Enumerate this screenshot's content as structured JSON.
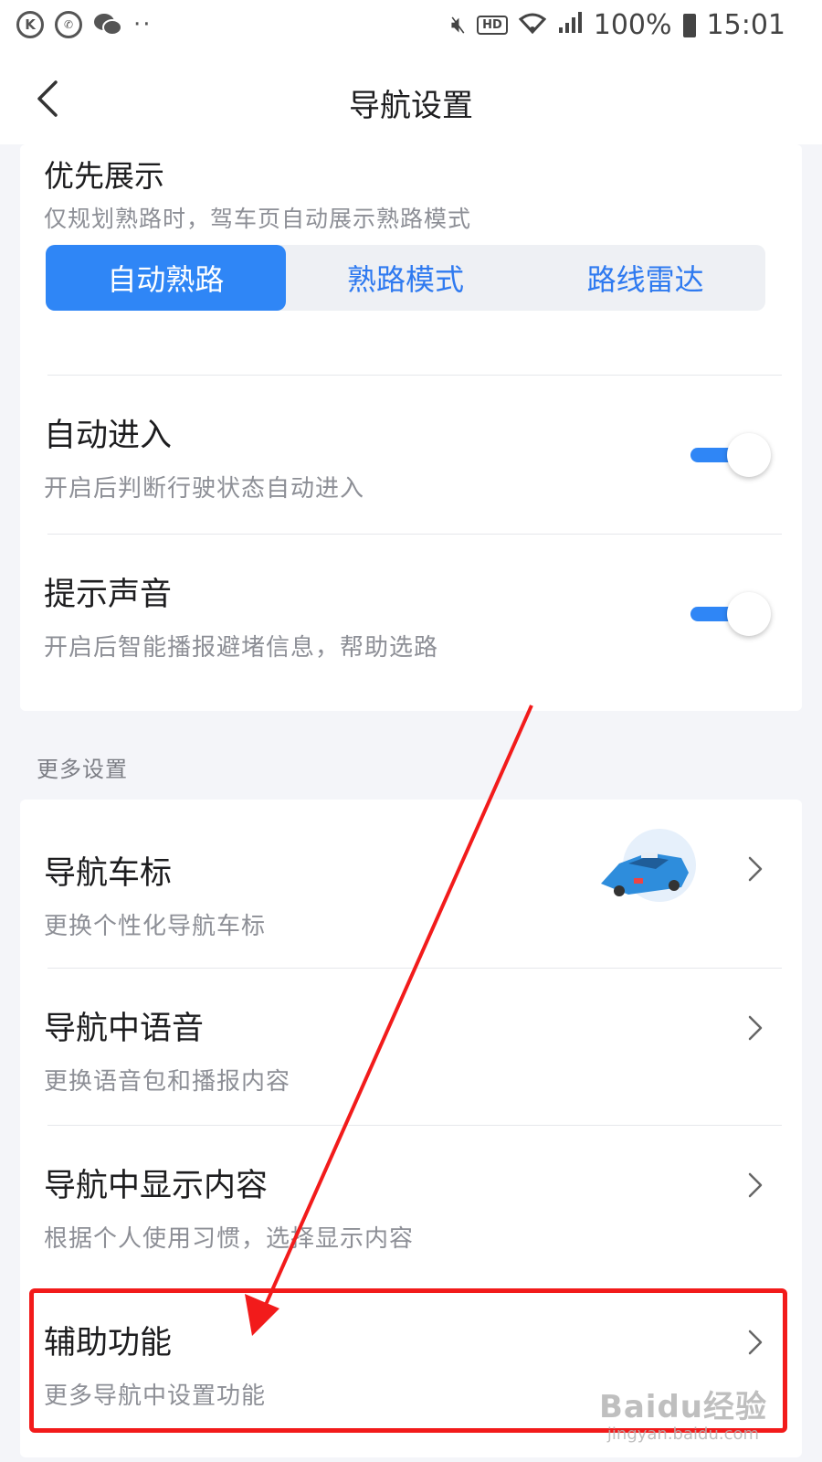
{
  "status_bar": {
    "left_icons": [
      "k-circle-icon",
      "wifi-calling-icon",
      "wechat-icon"
    ],
    "more_dots": "··",
    "hd": "HD",
    "battery": "100%",
    "time": "15:01"
  },
  "nav": {
    "title": "导航设置"
  },
  "priority": {
    "title": "优先展示",
    "desc": "仅规划熟路时，驾车页自动展示熟路模式",
    "options": [
      "自动熟路",
      "熟路模式",
      "路线雷达"
    ],
    "selected": "自动熟路"
  },
  "toggles": [
    {
      "title": "自动进入",
      "desc": "开启后判断行驶状态自动进入",
      "on": true
    },
    {
      "title": "提示声音",
      "desc": "开启后智能播报避堵信息，帮助选路",
      "on": true
    }
  ],
  "more": {
    "section_label": "更多设置",
    "items": [
      {
        "title": "导航车标",
        "desc": "更换个性化导航车标"
      },
      {
        "title": "导航中语音",
        "desc": "更换语音包和播报内容"
      },
      {
        "title": "导航中显示内容",
        "desc": "根据个人使用习惯，选择显示内容"
      },
      {
        "title": "辅助功能",
        "desc": "更多导航中设置功能"
      }
    ]
  },
  "colors": {
    "accent": "#2f86f6",
    "annotation": "#f21b1b"
  },
  "watermark": {
    "main": "Baidu经验",
    "sub": "jingyan.baidu.com"
  }
}
